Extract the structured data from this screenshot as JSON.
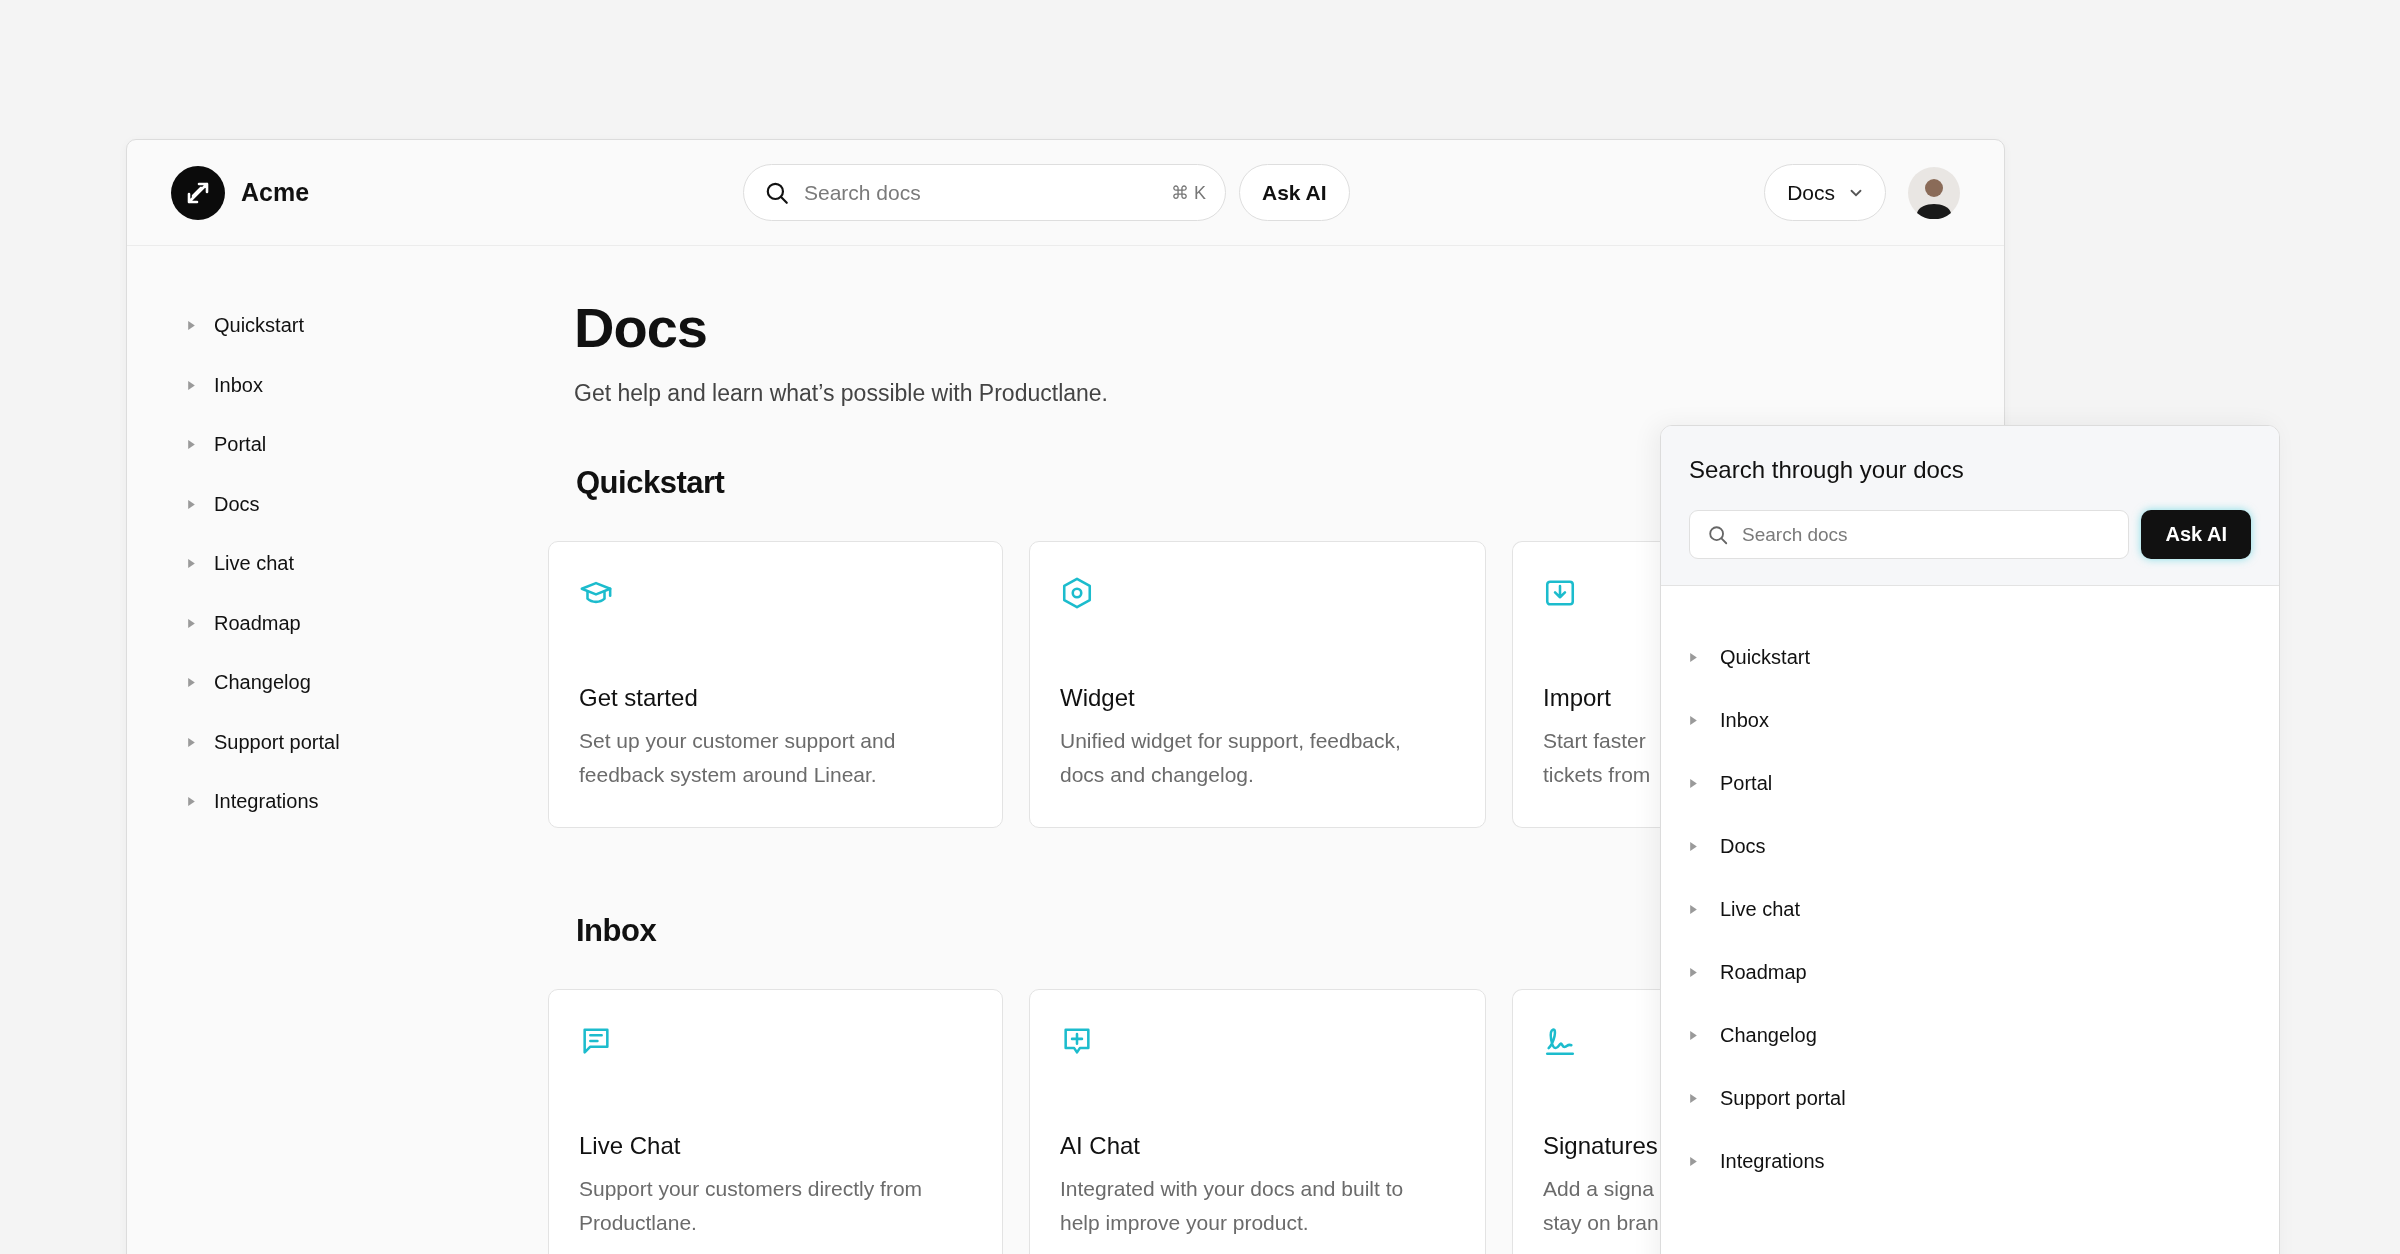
{
  "header": {
    "logo_text": "Acme",
    "search": {
      "placeholder": "Search docs",
      "shortcut": "⌘ K"
    },
    "ask_button": "Ask AI",
    "menu": "Docs"
  },
  "sidebar": {
    "items": [
      "Quickstart",
      "Inbox",
      "Portal",
      "Docs",
      "Live chat",
      "Roadmap",
      "Changelog",
      "Support portal",
      "Integrations"
    ]
  },
  "page": {
    "title": "Docs",
    "subtitle": "Get help and learn what’s possible with Productlane.",
    "sections": [
      {
        "heading": "Quickstart",
        "cards": [
          {
            "title": "Get started",
            "description_lines": [
              "Set up your customer support and",
              "feedback system around Linear."
            ]
          },
          {
            "title": "Widget",
            "description_lines": [
              "Unified widget for support, feedback,",
              "docs and changelog."
            ]
          },
          {
            "title": "Import",
            "description_lines": [
              "Start faster",
              "tickets from"
            ]
          }
        ]
      },
      {
        "heading": "Inbox",
        "cards": [
          {
            "title": "Live Chat",
            "description_lines": [
              "Support your customers directly from",
              "Productlane."
            ]
          },
          {
            "title": "AI Chat",
            "description_lines": [
              "Integrated with your docs and built to",
              "help improve your product."
            ]
          },
          {
            "title": "Signatures",
            "description_lines": [
              "Add a signa",
              "stay on bran"
            ]
          }
        ]
      }
    ]
  },
  "search_panel": {
    "title": "Search through your docs",
    "search": {
      "placeholder": "Search docs"
    },
    "ask_button": "Ask AI",
    "items": [
      "Quickstart",
      "Inbox",
      "Portal",
      "Docs",
      "Live chat",
      "Roadmap",
      "Changelog",
      "Support portal",
      "Integrations"
    ]
  }
}
